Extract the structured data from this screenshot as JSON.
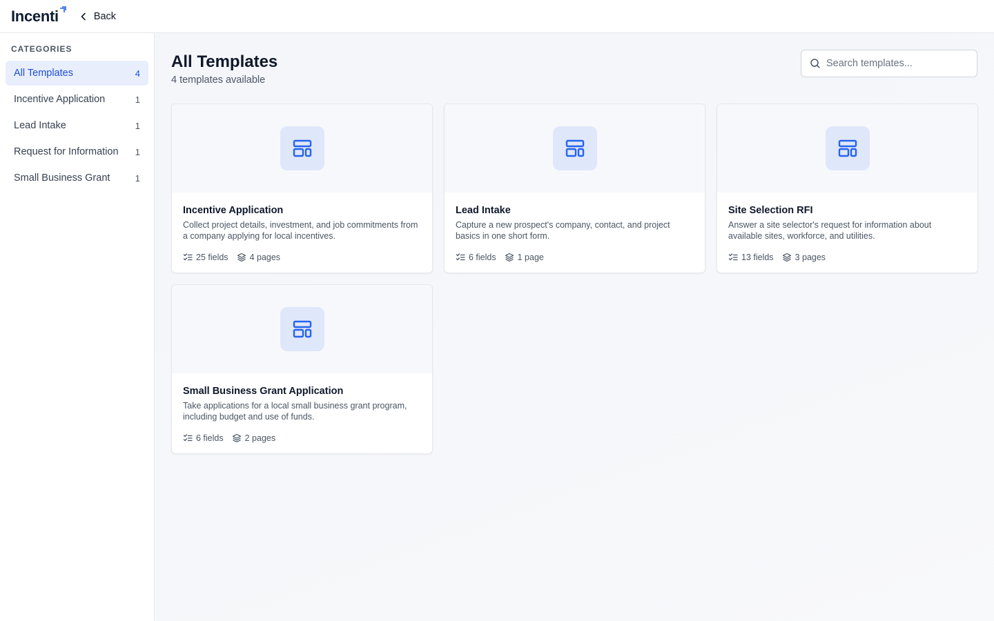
{
  "app": {
    "logo_text": "Incenti",
    "back_label": "Back"
  },
  "sidebar": {
    "heading": "CATEGORIES",
    "items": [
      {
        "label": "All Templates",
        "count": "4",
        "active": true
      },
      {
        "label": "Incentive Application",
        "count": "1"
      },
      {
        "label": "Lead Intake",
        "count": "1"
      },
      {
        "label": "Request for Information",
        "count": "1"
      },
      {
        "label": "Small Business Grant",
        "count": "1"
      }
    ]
  },
  "main": {
    "title": "All Templates",
    "subtitle": "4 templates available",
    "search": {
      "placeholder": "Search templates...",
      "value": ""
    },
    "templates": [
      {
        "title": "Incentive Application",
        "description": "Collect project details, investment, and job commitments from a company applying for local incentives.",
        "fields": "25 fields",
        "pages": "4 pages"
      },
      {
        "title": "Lead Intake",
        "description": "Capture a new prospect's company, contact, and project basics in one short form.",
        "fields": "6 fields",
        "pages": "1 page"
      },
      {
        "title": "Site Selection RFI",
        "description": "Answer a site selector's request for information about available sites, workforce, and utilities.",
        "fields": "13 fields",
        "pages": "3 pages"
      },
      {
        "title": "Small Business Grant Application",
        "description": "Take applications for a local small business grant program, including budget and use of funds.",
        "fields": "6 fields",
        "pages": "2 pages"
      }
    ]
  },
  "colors": {
    "accent": "#1d4ed8",
    "active_bg": "#e8eefc",
    "icon_bg": "#dfe7fb"
  },
  "icons": {
    "card": "layout-template-icon",
    "fields": "list-checks-icon",
    "pages": "layers-icon",
    "search": "search-icon",
    "back": "chevron-left-icon"
  }
}
